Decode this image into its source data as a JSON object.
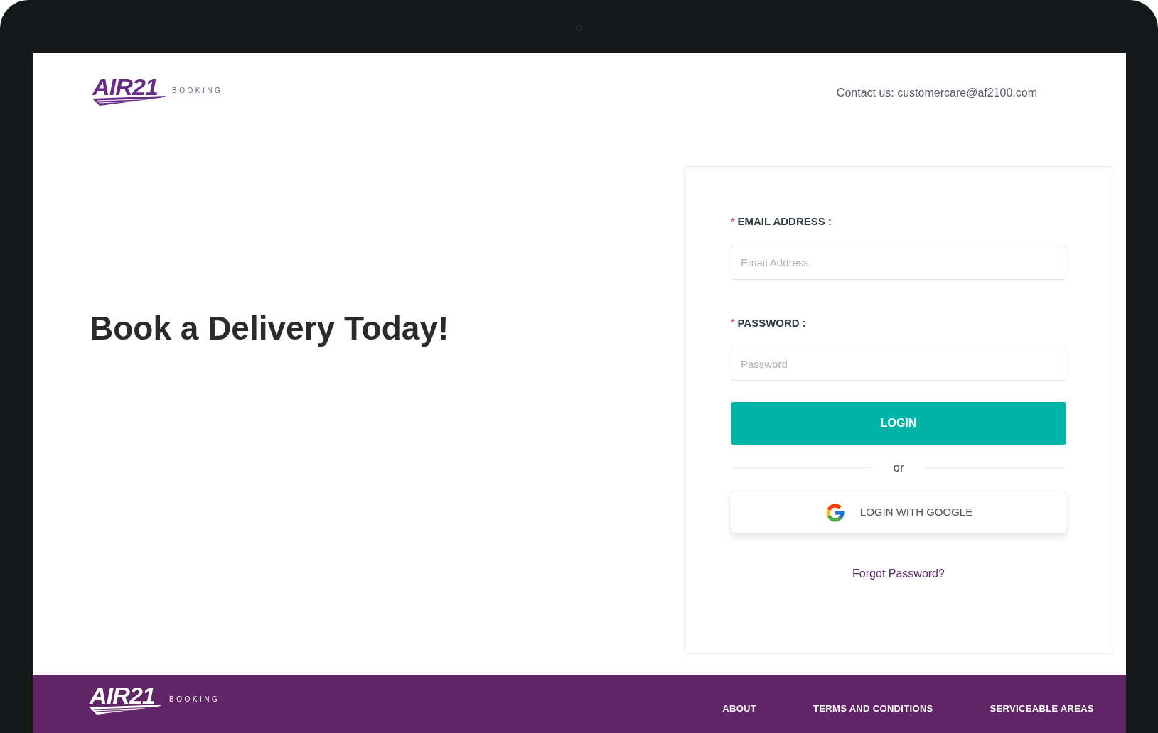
{
  "header": {
    "logo": {
      "mark": "AIR21",
      "sub": "BOOKING"
    },
    "contact": "Contact us: customercare@af2100.com"
  },
  "hero": {
    "title": "Book a Delivery Today!"
  },
  "login_form": {
    "required_mark": "*",
    "fields": [
      {
        "label": "EMAIL ADDRESS :",
        "required": true,
        "placeholder": "Email Address"
      },
      {
        "label": "PASSWORD :",
        "required": true,
        "placeholder": "Password"
      }
    ],
    "login_button": "LOGIN",
    "divider": "or",
    "google_button": "LOGIN WITH GOOGLE",
    "forgot_link": "Forgot Password?"
  },
  "footer": {
    "logo": {
      "mark": "AIR21",
      "sub": "BOOKING"
    },
    "links": [
      "ABOUT",
      "TERMS AND CONDITIONS",
      "SERVICEABLE AREAS"
    ]
  }
}
